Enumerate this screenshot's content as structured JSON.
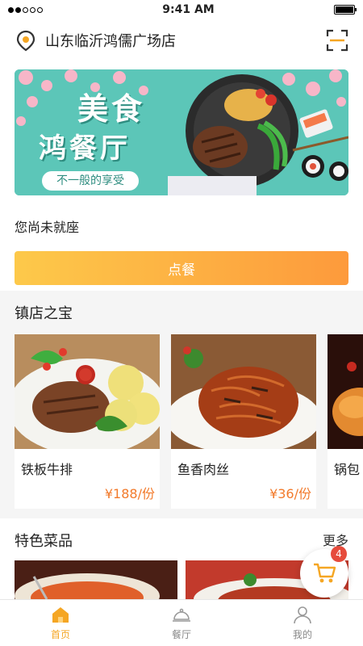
{
  "status_bar": {
    "time": "9:41 AM"
  },
  "header": {
    "store_name": "山东临沂鸿儒广场店",
    "location_icon": "location-pin-icon",
    "scan_icon": "scan-icon"
  },
  "banner": {
    "title_line1": "美食",
    "title_line2": "鸿餐厅",
    "slogan": "不一般的享受"
  },
  "seat_status": "您尚未就座",
  "order_button": "点餐",
  "treasure": {
    "title": "镇店之宝",
    "dishes": [
      {
        "name": "铁板牛排",
        "price": "¥188/份"
      },
      {
        "name": "鱼香肉丝",
        "price": "¥36/份"
      },
      {
        "name": "锅包"
      }
    ]
  },
  "featured": {
    "title": "特色菜品",
    "more": "更多"
  },
  "cart": {
    "badge": "4",
    "icon": "cart-icon"
  },
  "tabs": [
    {
      "label": "首页",
      "icon": "home-icon",
      "active": true
    },
    {
      "label": "餐厅",
      "icon": "dining-bell-icon",
      "active": false
    },
    {
      "label": "我的",
      "icon": "user-icon",
      "active": false
    }
  ],
  "colors": {
    "accent": "#f5a623",
    "price": "#f27a2b",
    "banner": "#57c3b5",
    "badge": "#e64b3c"
  }
}
